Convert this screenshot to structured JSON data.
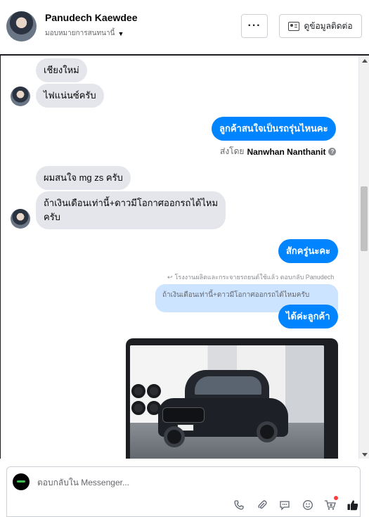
{
  "header": {
    "name": "Panudech Kaewdee",
    "assign_label": "มอบหมายการสนทนานี้",
    "more_label": "···",
    "contact_label": "ดูข้อมูลติดต่อ"
  },
  "messages": [
    {
      "side": "in",
      "text": "เชียงใหม่"
    },
    {
      "side": "in",
      "text": "ไฟแน่นซ์ครับ"
    },
    {
      "side": "out",
      "text": "ลูกค้าสนใจเป็นรถรุ่นไหนคะ"
    },
    {
      "side": "in",
      "text": "ผมสนใจ mg zs ครับ"
    },
    {
      "side": "in",
      "text": "ถ้าเงินเดือนเท่านี้+ดาวมีโอกาศออกรถได้ไหมครับ",
      "lines": [
        "ถ้าเงินเดือนเท่านี้+ดาวมีโอกาศออกรถได้ไหม",
        "ครับ"
      ]
    },
    {
      "side": "out",
      "text": "สักครู่นะคะ"
    },
    {
      "side": "out",
      "text": "ได้ค่ะลูกค้า"
    }
  ],
  "sent_by": {
    "prefix": "ส่งโดย",
    "name": "Nanwhan Nanthanit",
    "help": "?"
  },
  "reply": {
    "hint": "โรงงานผลิตและกระจายรถยนต์ใช้แล้ว ตอบกลับ Panudech",
    "quoted": "ถ้าเงินเดือนเท่านี้+ดาวมีโอกาศออกรถได้ไหมครับ"
  },
  "photo": {
    "plate_text": "ทขจ 1179"
  },
  "composer": {
    "placeholder": "ตอบกลับใน Messenger..."
  },
  "icons": {
    "phone": "phone-icon",
    "attach": "paperclip-icon",
    "saved_replies": "chat-bubble-icon",
    "emoji": "smiley-icon",
    "cart": "cart-plus-icon",
    "like": "thumbs-up-icon"
  },
  "colors": {
    "outgoing": "#0084ff",
    "incoming": "#e4e6eb",
    "quoted_reply": "#cce4ff",
    "like_button": "#1c1e21",
    "notification_dot": "#fa3e3e"
  }
}
